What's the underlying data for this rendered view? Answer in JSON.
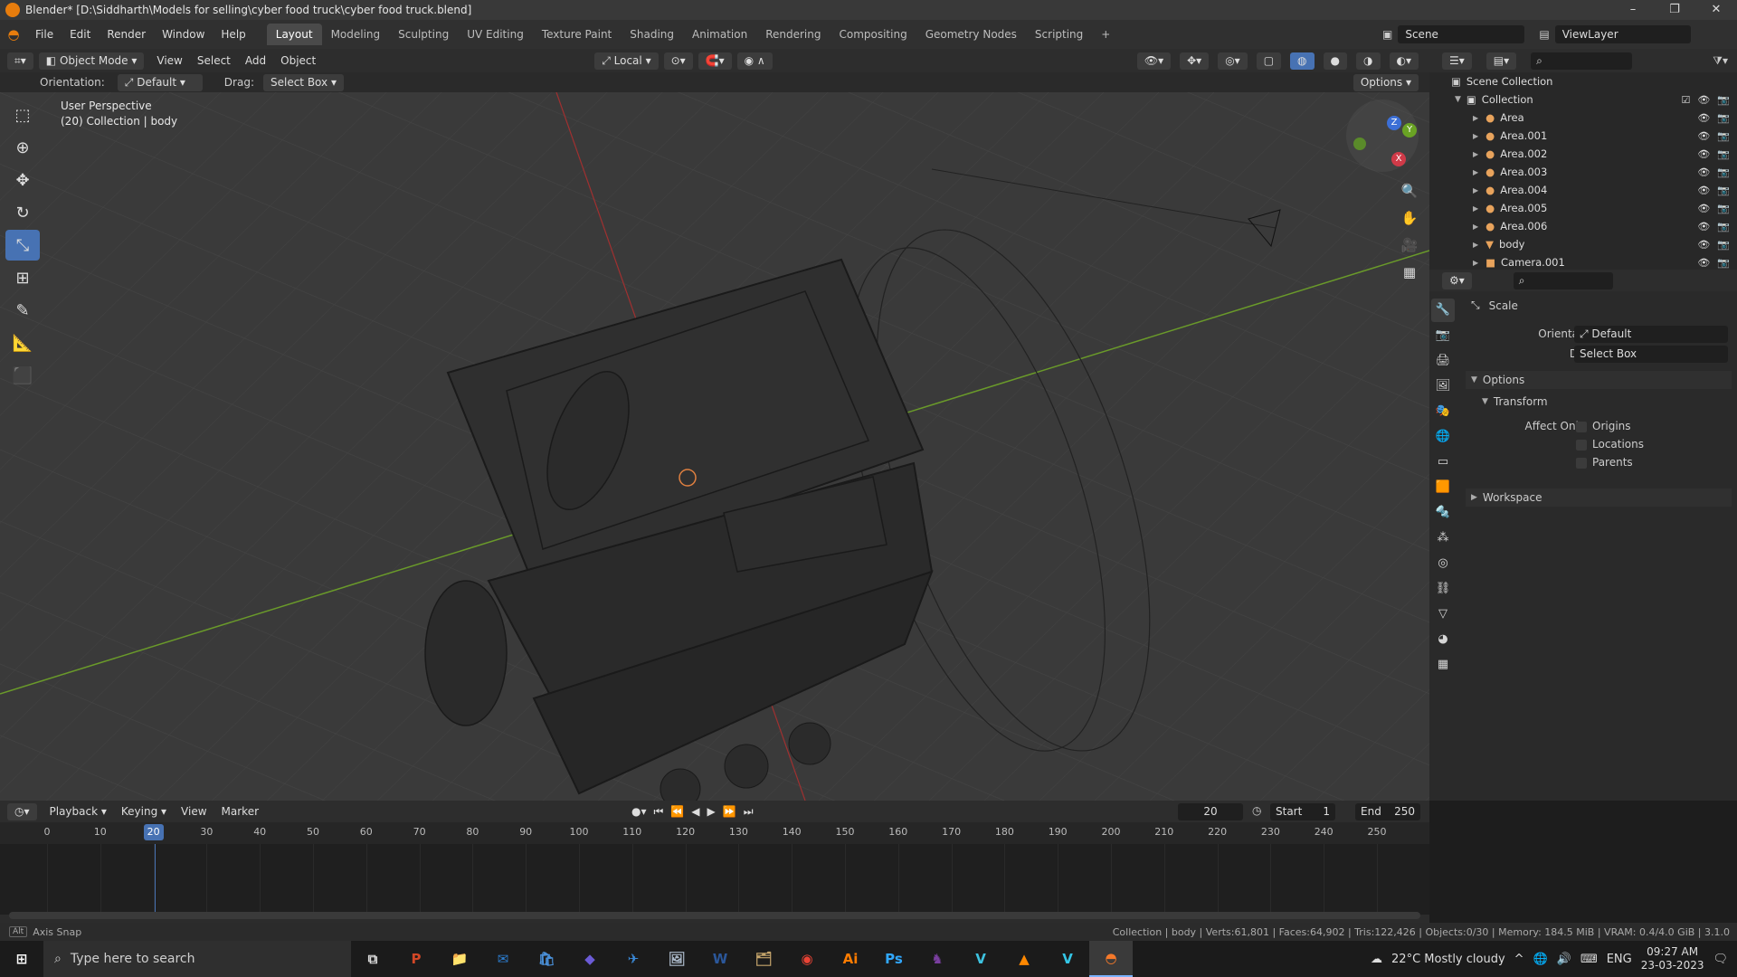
{
  "window": {
    "title": "Blender* [D:\\Siddharth\\Models for selling\\cyber food truck\\cyber food truck.blend]",
    "min": "–",
    "max": "❐",
    "close": "✕"
  },
  "menu": [
    "File",
    "Edit",
    "Render",
    "Window",
    "Help"
  ],
  "workspaces": [
    "Layout",
    "Modeling",
    "Sculpting",
    "UV Editing",
    "Texture Paint",
    "Shading",
    "Animation",
    "Rendering",
    "Compositing",
    "Geometry Nodes",
    "Scripting",
    "+"
  ],
  "scene": {
    "name": "Scene",
    "viewlayer": "ViewLayer"
  },
  "viewport_header": {
    "mode": "Object Mode",
    "menus": [
      "View",
      "Select",
      "Add",
      "Object"
    ],
    "transform_orientation": "Local"
  },
  "tool_header": {
    "orientation_label": "Orientation:",
    "orientation_value": "Default",
    "drag_label": "Drag:",
    "drag_value": "Select Box",
    "options": "Options"
  },
  "viewport": {
    "perspective": "User Perspective",
    "collection_info": "(20) Collection | body"
  },
  "gizmo": {
    "x": "X",
    "y": "Y",
    "z": "Z"
  },
  "outliner": {
    "scene_collection": "Scene Collection",
    "collection": "Collection",
    "items": [
      "Area",
      "Area.001",
      "Area.002",
      "Area.003",
      "Area.004",
      "Area.005",
      "Area.006",
      "body",
      "Camera.001"
    ]
  },
  "properties": {
    "tool_name": "Scale",
    "orientation_label": "Orientation",
    "orientation_value": "Default",
    "drag_label": "Drag:",
    "drag_value": "Select Box",
    "options_panel": "Options",
    "transform_panel": "Transform",
    "affect_only": "Affect Only",
    "checks": [
      "Origins",
      "Locations",
      "Parents"
    ],
    "workspace_panel": "Workspace"
  },
  "timeline": {
    "menus": [
      "Playback",
      "Keying",
      "View",
      "Marker"
    ],
    "current_frame": "20",
    "start_label": "Start",
    "start": "1",
    "end_label": "End",
    "end": "250",
    "ticks": [
      "0",
      "10",
      "20",
      "30",
      "40",
      "50",
      "60",
      "70",
      "80",
      "90",
      "100",
      "110",
      "120",
      "130",
      "140",
      "150",
      "160",
      "170",
      "180",
      "190",
      "200",
      "210",
      "220",
      "230",
      "240",
      "250"
    ],
    "playhead_frame": 20
  },
  "status": {
    "left": "Axis Snap",
    "right": "Collection | body | Verts:61,801 | Faces:64,902 | Tris:122,426 | Objects:0/30 | Memory: 184.5 MiB | VRAM: 0.4/4.0 GiB | 3.1.0"
  },
  "taskbar": {
    "search_placeholder": "Type here to search",
    "apps": [
      "P",
      "📁",
      "✉",
      "🛍",
      "◆",
      "✈",
      "🖼",
      "W",
      "🗂",
      "◉",
      "Ai",
      "Ps",
      "♞",
      "V",
      "▲",
      "V",
      "◓"
    ],
    "weather": "22°C  Mostly cloudy",
    "lang": "ENG",
    "time": "09:27 AM",
    "date": "23-03-2023"
  }
}
